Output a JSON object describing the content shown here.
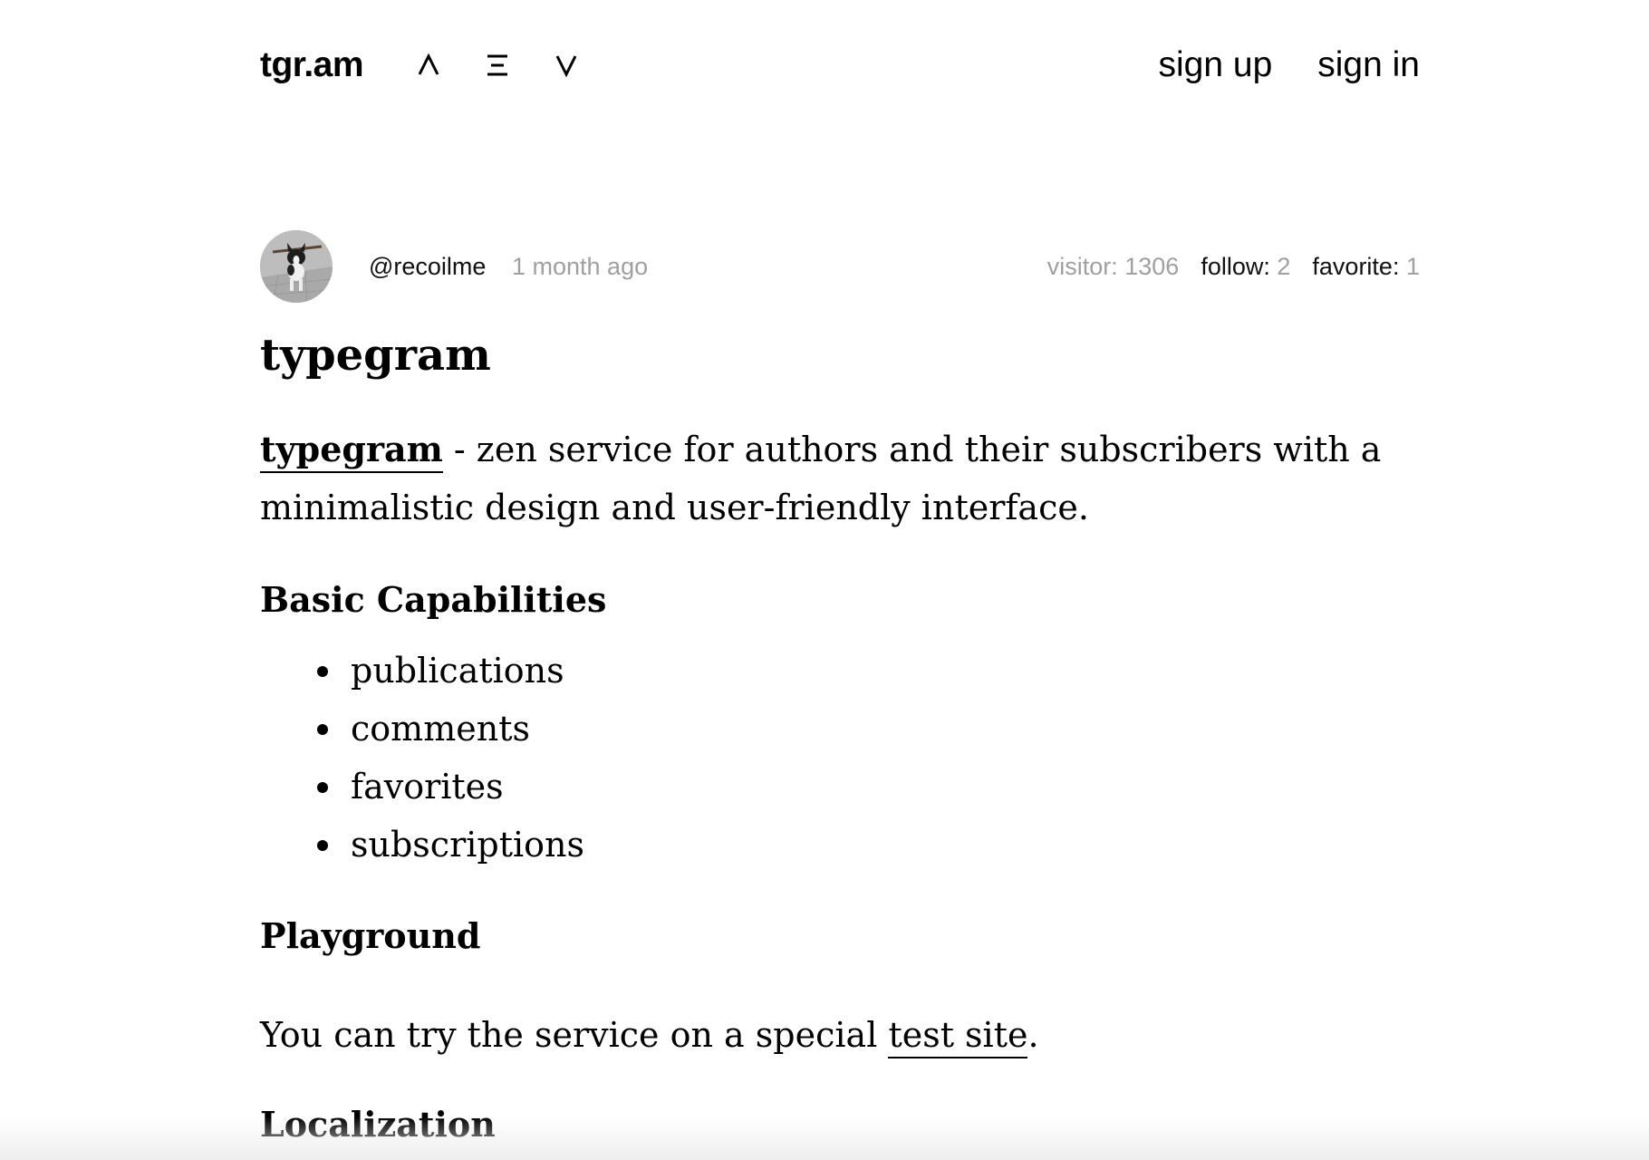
{
  "header": {
    "logo": "tgr.am",
    "nav_icons": [
      "caret-up-icon",
      "menu-icon",
      "caret-down-icon"
    ],
    "sign_up": "sign up",
    "sign_in": "sign in"
  },
  "post": {
    "author": "@recoilme",
    "time": "1 month ago",
    "stats": {
      "visitor_label": "visitor:",
      "visitor_value": "1306",
      "follow_label": "follow:",
      "follow_value": "2",
      "favorite_label": "favorite:",
      "favorite_value": "1"
    }
  },
  "article": {
    "title": "typegram",
    "intro_link": "typegram",
    "intro_text": " - zen service for authors and their subscribers with a minimalistic design and user-friendly interface.",
    "basic_heading": "Basic Capabilities",
    "capabilities": [
      "publications",
      "comments",
      "favorites",
      "subscriptions"
    ],
    "playground_heading": "Playground",
    "playground_text": "You can try the service on a special ",
    "playground_link": "test site",
    "playground_end": ".",
    "localization_heading": "Localization"
  },
  "colors": {
    "text": "#000000",
    "muted": "#a0a0a0",
    "background": "#ffffff"
  }
}
